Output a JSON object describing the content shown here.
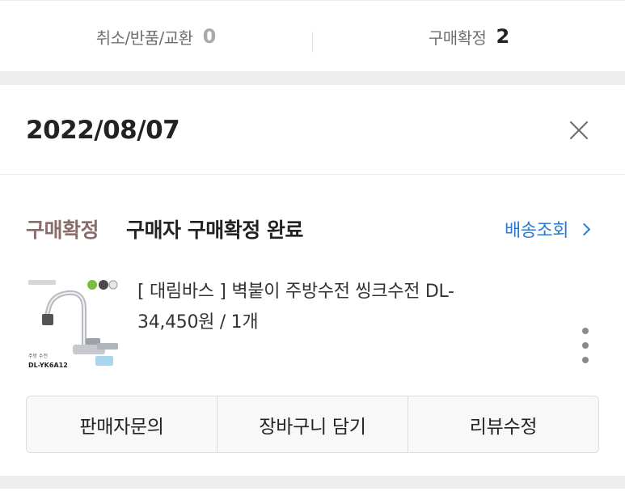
{
  "summary": {
    "cancel_label": "취소/반품/교환",
    "cancel_count": "0",
    "confirm_label": "구매확정",
    "confirm_count": "2"
  },
  "order": {
    "date": "2022/08/07",
    "status_tag": "구매확정",
    "status_desc": "구매자 구매확정 완료",
    "tracking_label": "배송조회",
    "product": {
      "name": "[ 대림바스 ] 벽붙이 주방수전 씽크수전 DL-",
      "price_qty": "34,450원 / 1개",
      "thumb_caption_small": "주방 수전",
      "thumb_model": "DL-YK6A12"
    },
    "actions": [
      "판매자문의",
      "장바구니 담기",
      "리뷰수정"
    ]
  },
  "icons": {
    "close": "close-icon",
    "chevron": "chevron-right-icon",
    "more": "more-vertical-icon"
  },
  "colors": {
    "status_tag": "#8c6b6b",
    "link": "#2a7bd3"
  }
}
